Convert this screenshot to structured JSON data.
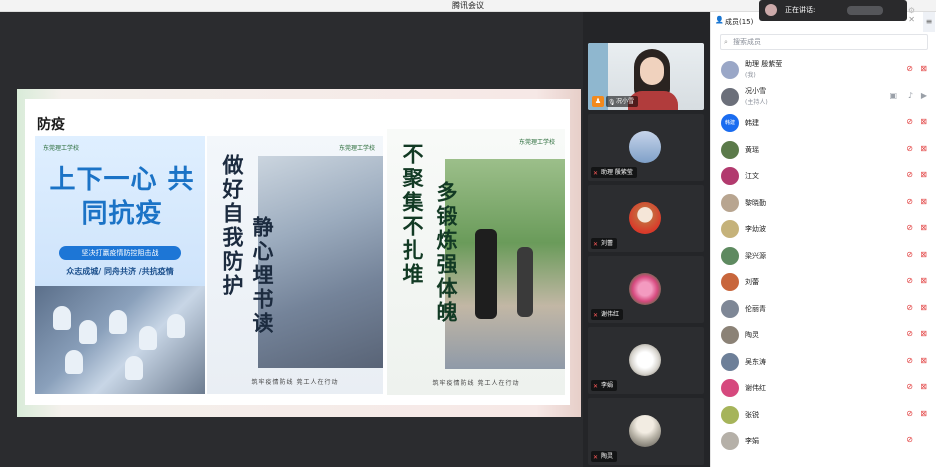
{
  "window": {
    "title": "腾讯会议"
  },
  "toast": {
    "label": "正在讲话:"
  },
  "slide": {
    "title": "防疫",
    "poster1": {
      "logo": "东莞理工学校",
      "headline": "上下一心 共同抗疫",
      "pill": "坚决打赢疫情防控阻击战",
      "sub": "众志成城/ 同舟共济 /共抗疫情"
    },
    "poster2": {
      "logo": "东莞理工学校",
      "col1": "做好自我防护",
      "col2": "静心埋书读",
      "footer": "筑牢疫情防线  莞工人在行动"
    },
    "poster3": {
      "logo": "东莞理工学校",
      "col1": "不聚集不扎堆",
      "col2": "多锻炼强体魄",
      "footer": "筑牢疫情防线  莞工人在行动"
    }
  },
  "video_tiles": [
    {
      "name": "况小雪",
      "color": "#f28a1e"
    },
    {
      "name": "助理 殷紫莹",
      "color": "#7fa0c8"
    },
    {
      "name": "刘蕾",
      "color": "#c8663c"
    },
    {
      "name": "谢伟红",
      "color": "#d6497e"
    },
    {
      "name": "李娟",
      "color": "#d9d6d0"
    },
    {
      "name": "陶灵",
      "color": "#b7b2a6"
    }
  ],
  "panel": {
    "title": "成员(15)",
    "search_placeholder": "搜索成员",
    "members": [
      {
        "name": "助理 殷紫莹",
        "role": "(我)",
        "avatar_color": "#9aa7c7"
      },
      {
        "name": "况小雪",
        "role": "(主持人)",
        "avatar_color": "#6b6f7a"
      },
      {
        "name": "韩建",
        "role": "",
        "avatar_text": "韩建",
        "avatar_color": "#1a6cf0"
      },
      {
        "name": "黄瑶",
        "role": "",
        "avatar_color": "#5b7a4a"
      },
      {
        "name": "江文",
        "role": "",
        "avatar_color": "#b23a6e"
      },
      {
        "name": "黎晓勤",
        "role": "",
        "avatar_color": "#b8a590"
      },
      {
        "name": "李幼波",
        "role": "",
        "avatar_color": "#c5b27a"
      },
      {
        "name": "梁兴源",
        "role": "",
        "avatar_color": "#5e8a60"
      },
      {
        "name": "刘蕾",
        "role": "",
        "avatar_color": "#c8663c"
      },
      {
        "name": "伦丽青",
        "role": "",
        "avatar_color": "#7e8796"
      },
      {
        "name": "陶灵",
        "role": "",
        "avatar_color": "#8b8276"
      },
      {
        "name": "吴东涛",
        "role": "",
        "avatar_color": "#6d7f98"
      },
      {
        "name": "谢伟红",
        "role": "",
        "avatar_color": "#d6497e"
      },
      {
        "name": "张锐",
        "role": "",
        "avatar_color": "#a6b45a"
      },
      {
        "name": "李娟",
        "role": "",
        "avatar_color": "#b5b0a8"
      }
    ]
  }
}
